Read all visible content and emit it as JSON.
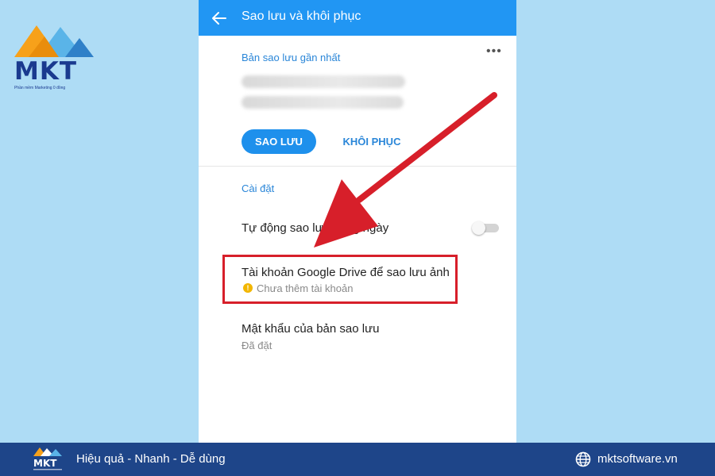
{
  "brand": {
    "logo_text": "MKT",
    "logo_tagline": "Phần mềm Marketing 0 đồng",
    "colors": {
      "navy": "#1a3a8f",
      "orange": "#f7a11a",
      "light_blue": "#5ab4e8"
    }
  },
  "app": {
    "title": "Sao lưu và khôi phục",
    "accent_color": "#2196f3",
    "icons": {
      "back": "arrow-left-icon",
      "more": "more-horizontal-icon"
    }
  },
  "backup": {
    "latest_label": "Bản sao lưu gần nhất",
    "backup_button": "SAO LƯU",
    "restore_button": "KHÔI PHỤC"
  },
  "settings": {
    "section_label": "Cài đặt",
    "auto_backup": {
      "label": "Tự động sao lưu hằng ngày",
      "enabled": false
    },
    "google_drive": {
      "label": "Tài khoản Google Drive để sao lưu ảnh",
      "status": "Chưa thêm tài khoản",
      "status_icon": "warning-icon"
    },
    "password": {
      "label": "Mật khẩu của bản sao lưu",
      "status": "Đã đặt"
    }
  },
  "annotation": {
    "color": "#d71f2a"
  },
  "footer": {
    "slogan": "Hiệu quả - Nhanh - Dễ dùng",
    "website": "mktsoftware.vn",
    "background": "#1e4589"
  }
}
